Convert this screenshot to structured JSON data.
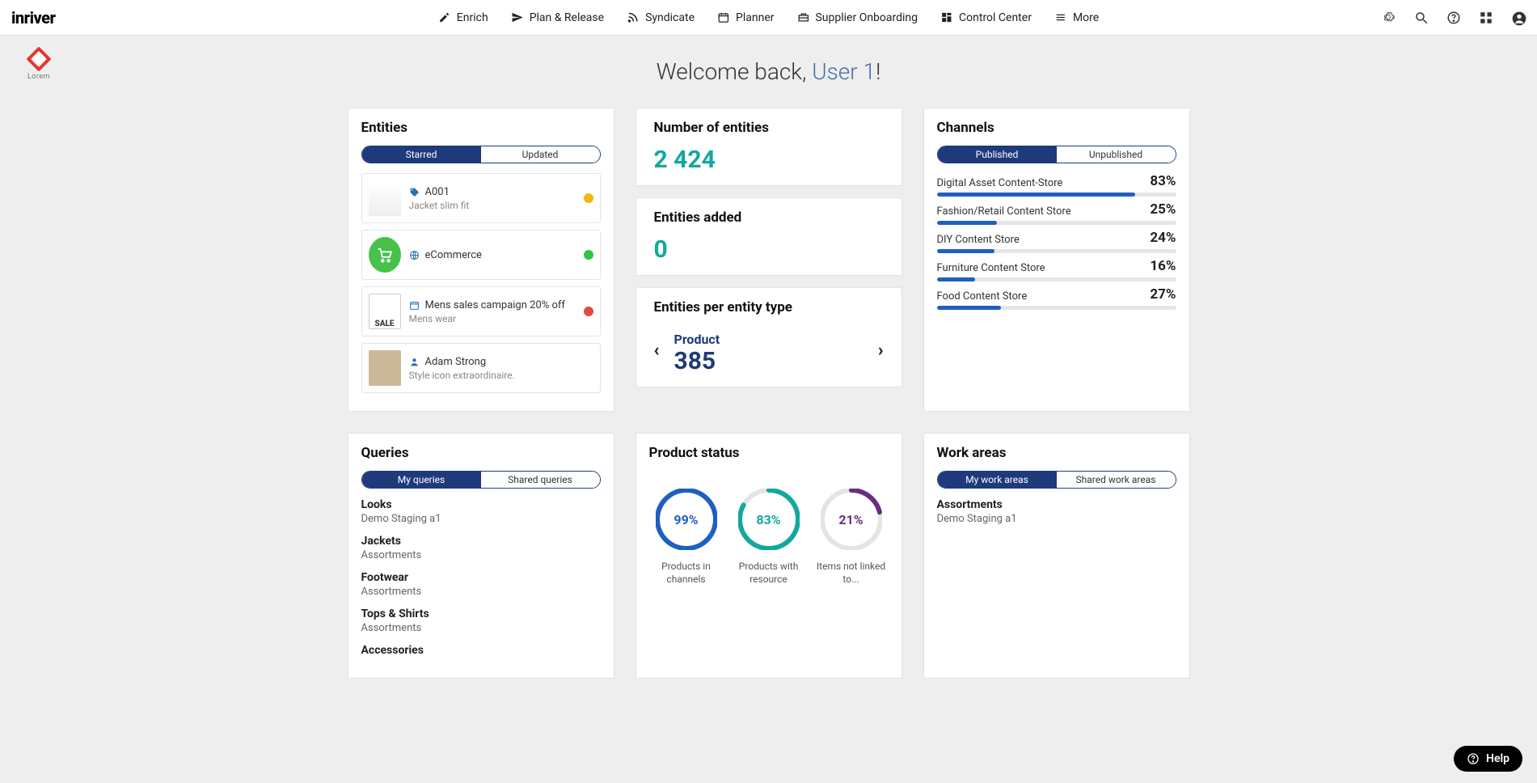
{
  "brand": "inriver",
  "stamp_text": "Lorem",
  "nav": [
    {
      "label": "Enrich",
      "icon": "edit-note-icon"
    },
    {
      "label": "Plan & Release",
      "icon": "paper-plane-icon"
    },
    {
      "label": "Syndicate",
      "icon": "rss-icon"
    },
    {
      "label": "Planner",
      "icon": "calendar-icon"
    },
    {
      "label": "Supplier Onboarding",
      "icon": "supplier-icon"
    },
    {
      "label": "Control Center",
      "icon": "dashboard-icon"
    },
    {
      "label": "More",
      "icon": "menu-icon"
    }
  ],
  "welcome_prefix": "Welcome back, ",
  "welcome_user": "User 1",
  "welcome_suffix": "!",
  "entities_card": {
    "title": "Entities",
    "tabs": {
      "a": "Starred",
      "b": "Updated"
    },
    "items": [
      {
        "code": "A001",
        "sub": "Jacket slim fit",
        "icon": "tag-icon",
        "dot": "#f2b90c"
      },
      {
        "code": "eCommerce",
        "sub": "",
        "icon": "globe-icon",
        "dot": "#2fc441"
      },
      {
        "code": "Mens sales campaign 20% off",
        "sub": "Mens wear",
        "icon": "calendar-small-icon",
        "dot": "#e14b3a"
      },
      {
        "code": "Adam Strong",
        "sub": "Style icon extraordinaire.",
        "icon": "person-icon",
        "dot": ""
      }
    ]
  },
  "numbers": {
    "title": "Number of entities",
    "value": "2 424"
  },
  "added": {
    "title": "Entities added",
    "value": "0"
  },
  "pertype": {
    "title": "Entities per entity type",
    "label": "Product",
    "value": "385"
  },
  "channels": {
    "title": "Channels",
    "tabs": {
      "a": "Published",
      "b": "Unpublished"
    },
    "items": [
      {
        "name": "Digital Asset Content-Store",
        "pct": "83%",
        "w": 83
      },
      {
        "name": "Fashion/Retail Content Store",
        "pct": "25%",
        "w": 25
      },
      {
        "name": "DIY Content Store",
        "pct": "24%",
        "w": 24
      },
      {
        "name": "Furniture Content Store",
        "pct": "16%",
        "w": 16
      },
      {
        "name": "Food Content Store",
        "pct": "27%",
        "w": 27
      }
    ]
  },
  "queries": {
    "title": "Queries",
    "tabs": {
      "a": "My queries",
      "b": "Shared queries"
    },
    "items": [
      {
        "t": "Looks",
        "s": "Demo Staging a1"
      },
      {
        "t": "Jackets",
        "s": "Assortments"
      },
      {
        "t": "Footwear",
        "s": "Assortments"
      },
      {
        "t": "Tops & Shirts",
        "s": "Assortments"
      },
      {
        "t": "Accessories",
        "s": ""
      }
    ]
  },
  "product_status": {
    "title": "Product status",
    "items": [
      {
        "pct": "99%",
        "v": 99,
        "color": "#1f5fbf",
        "cap": "Products in channels"
      },
      {
        "pct": "83%",
        "v": 83,
        "color": "#13a89e",
        "cap": "Products with resource"
      },
      {
        "pct": "21%",
        "v": 21,
        "color": "#6b2d82",
        "cap": "Items not linked to..."
      }
    ]
  },
  "workareas": {
    "title": "Work areas",
    "tabs": {
      "a": "My work areas",
      "b": "Shared work areas"
    },
    "items": [
      {
        "t": "Assortments",
        "s": "Demo Staging a1"
      }
    ]
  },
  "help_label": "Help",
  "chart_data": [
    {
      "type": "bar",
      "orientation": "horizontal",
      "title": "Channels – Published completeness (%)",
      "xlabel": "%",
      "ylabel": "",
      "xlim": [
        0,
        100
      ],
      "categories": [
        "Digital Asset Content-Store",
        "Fashion/Retail Content Store",
        "DIY Content Store",
        "Furniture Content Store",
        "Food Content Store"
      ],
      "values": [
        83,
        25,
        24,
        16,
        27
      ]
    },
    {
      "type": "pie",
      "title": "Product status",
      "series": [
        {
          "name": "Products in channels",
          "values": [
            99,
            1
          ]
        },
        {
          "name": "Products with resource",
          "values": [
            83,
            17
          ]
        },
        {
          "name": "Items not linked to...",
          "values": [
            21,
            79
          ]
        }
      ]
    }
  ]
}
